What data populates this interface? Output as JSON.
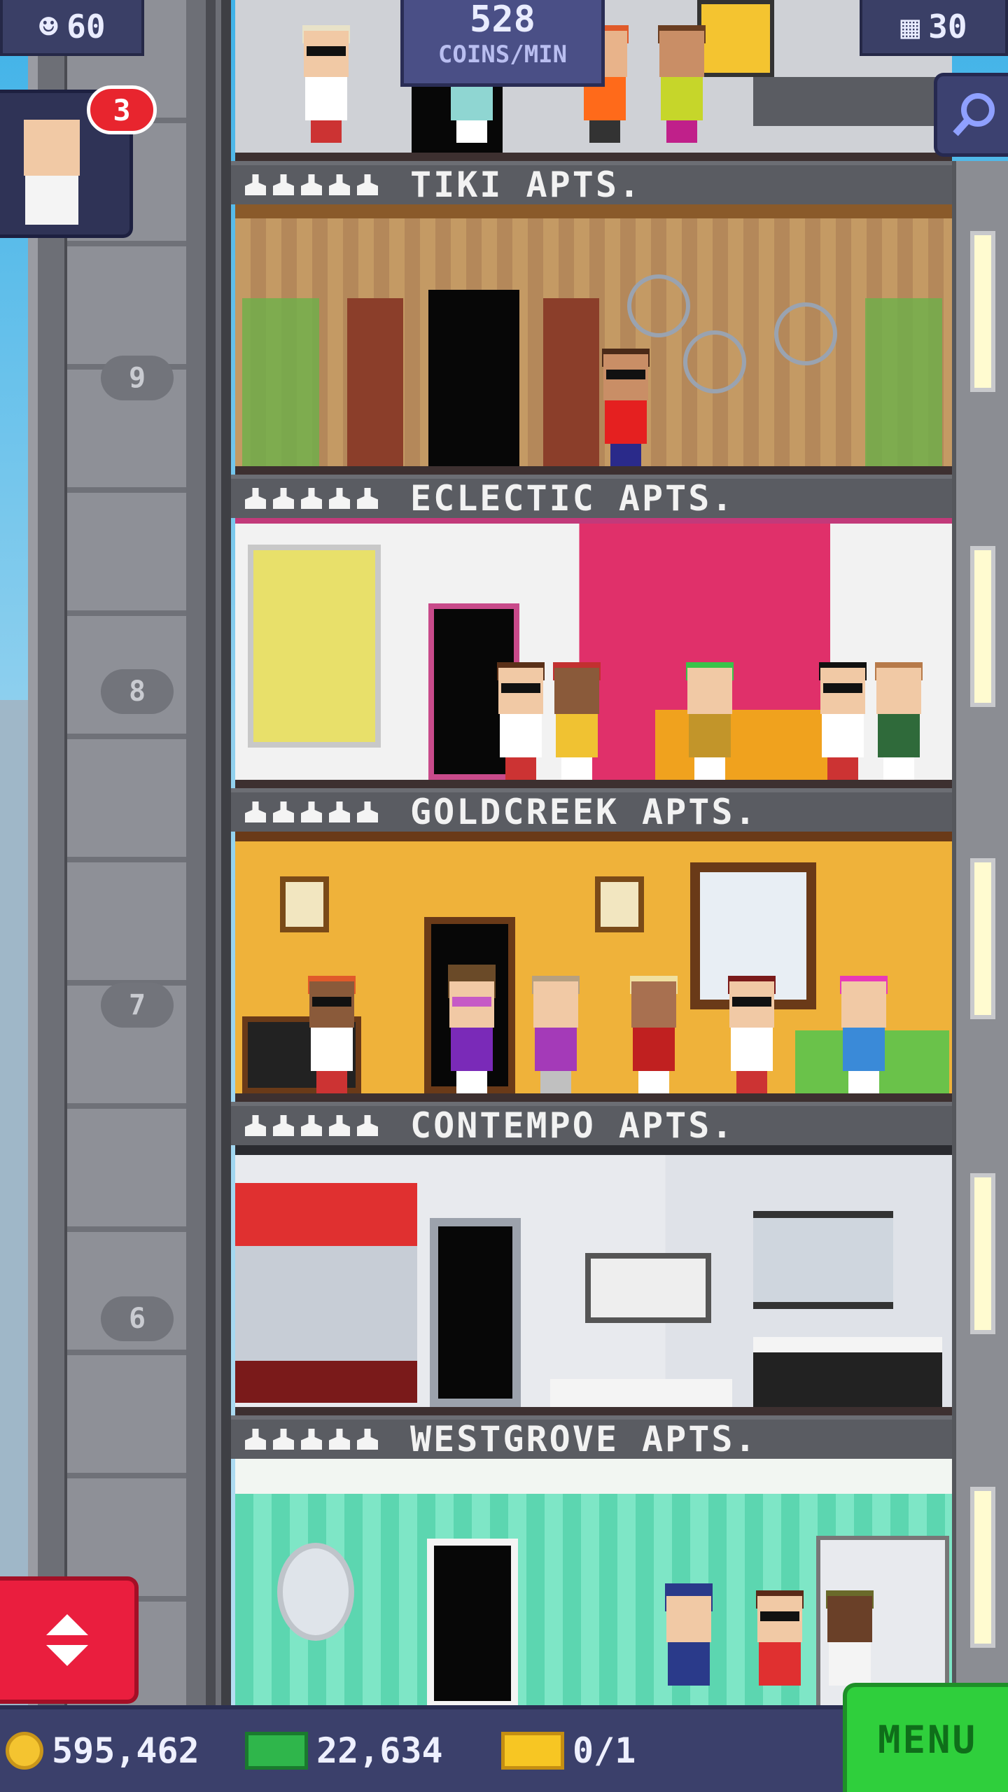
{
  "top_bar": {
    "population": "60",
    "coins_rate_value": "528",
    "coins_rate_label": "COINS/MIN",
    "floors": "30",
    "vip_badge_count": "3"
  },
  "floors": [
    {
      "number": "9",
      "name": "TIKI APTS."
    },
    {
      "number": "8",
      "name": "ECLECTIC APTS."
    },
    {
      "number": "7",
      "name": "GOLDCREEK APTS."
    },
    {
      "number": "6",
      "name": "CONTEMPO APTS."
    },
    {
      "number": "",
      "name": "WESTGROVE APTS."
    }
  ],
  "bottom_bar": {
    "coins": "595,462",
    "bux": "22,634",
    "tickets": "0/1",
    "menu_label": "MENU"
  },
  "colors": {
    "menu_green": "#2fcf3c",
    "elevator_red": "#ea1e3e",
    "bar_navy": "#3b406b",
    "badge_red": "#e8252e"
  },
  "icons": [
    "population-icon",
    "floors-icon",
    "search-icon",
    "coin-icon",
    "bux-icon",
    "ticket-icon",
    "elevator-up-down-icon"
  ]
}
